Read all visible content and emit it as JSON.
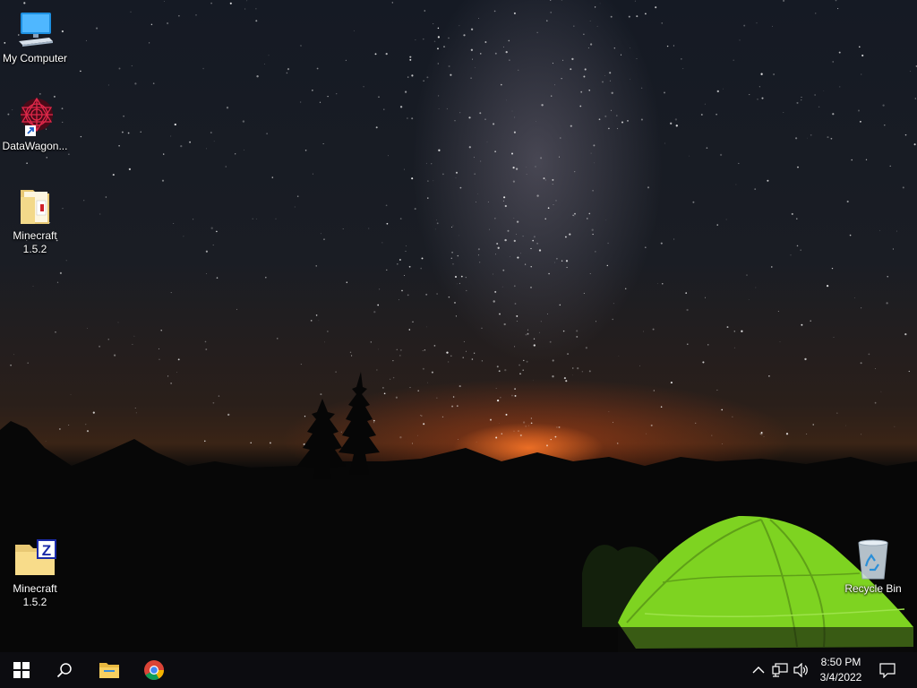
{
  "desktop": {
    "icons": [
      {
        "label": "My Computer"
      },
      {
        "label": "DataWagon..."
      },
      {
        "label": "Minecraft\n1.5.2"
      },
      {
        "label": "Minecraft\n1.5.2"
      },
      {
        "label": "Recycle Bin"
      }
    ]
  },
  "taskbar": {
    "pinned": [
      {
        "icon": "windows-start-icon"
      },
      {
        "icon": "search-icon"
      },
      {
        "icon": "file-explorer-icon"
      },
      {
        "icon": "chrome-icon"
      }
    ],
    "tray": {
      "icons": [
        "chevron-up-icon",
        "network-icon",
        "volume-icon",
        "action-center-icon"
      ],
      "time": "8:50 PM",
      "date": "3/4/2022"
    }
  },
  "colors": {
    "taskbar_bg": "#0c0c10",
    "tent_green": "#7ed321",
    "horizon_orange": "#ff7a2a"
  }
}
